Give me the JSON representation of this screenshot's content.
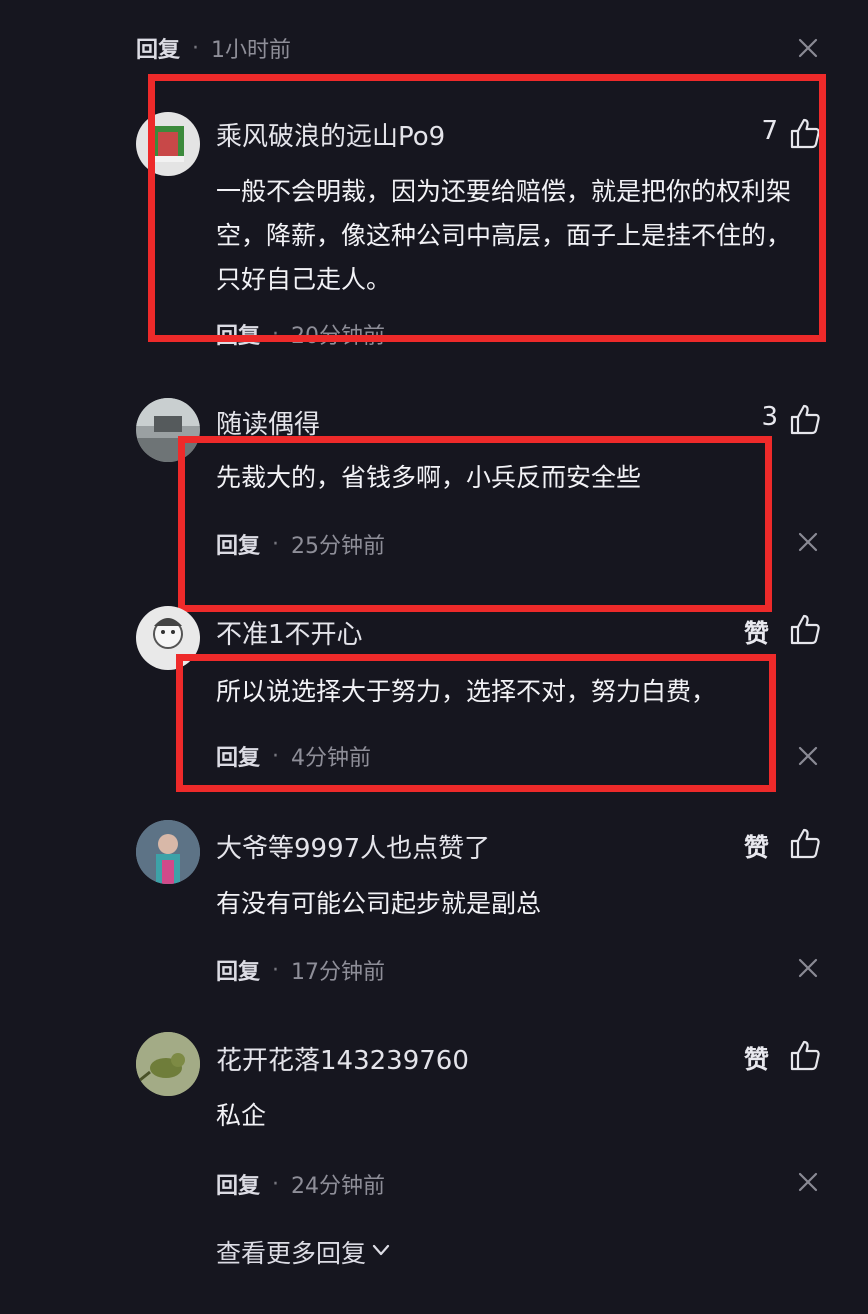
{
  "colors": {
    "background": "#16161f",
    "highlight_box": "#ee2a2a",
    "text": "#f2f2f6",
    "meta": "#8e8e98"
  },
  "top_reply": {
    "reply_label": "回复",
    "time": "1小时前"
  },
  "comments": [
    {
      "name": "乘风破浪的远山Po9",
      "likes": "7",
      "text": "一般不会明裁，因为还要给赔偿，就是把你的权利架空，降薪，像这种公司中高层，面子上是挂不住的，只好自己走人。",
      "reply_label": "回复",
      "time": "20分钟前"
    },
    {
      "name": "随读偶得",
      "likes": "3",
      "text": "先裁大的，省钱多啊，小兵反而安全些",
      "reply_label": "回复",
      "time": "25分钟前"
    },
    {
      "name": "不准1不开心",
      "likes": "赞",
      "text": "所以说选择大于努力，选择不对，努力白费，",
      "reply_label": "回复",
      "time": "4分钟前"
    },
    {
      "name": "大爷等9997人也点赞了",
      "likes": "赞",
      "text": "有没有可能公司起步就是副总",
      "reply_label": "回复",
      "time": "17分钟前"
    },
    {
      "name": "花开花落143239760",
      "likes": "赞",
      "text": "私企",
      "reply_label": "回复",
      "time": "24分钟前"
    }
  ],
  "view_more": "查看更多回复",
  "icons": {
    "close": "close-icon",
    "like": "thumbs-up-icon",
    "expand": "chevron-down-icon"
  }
}
